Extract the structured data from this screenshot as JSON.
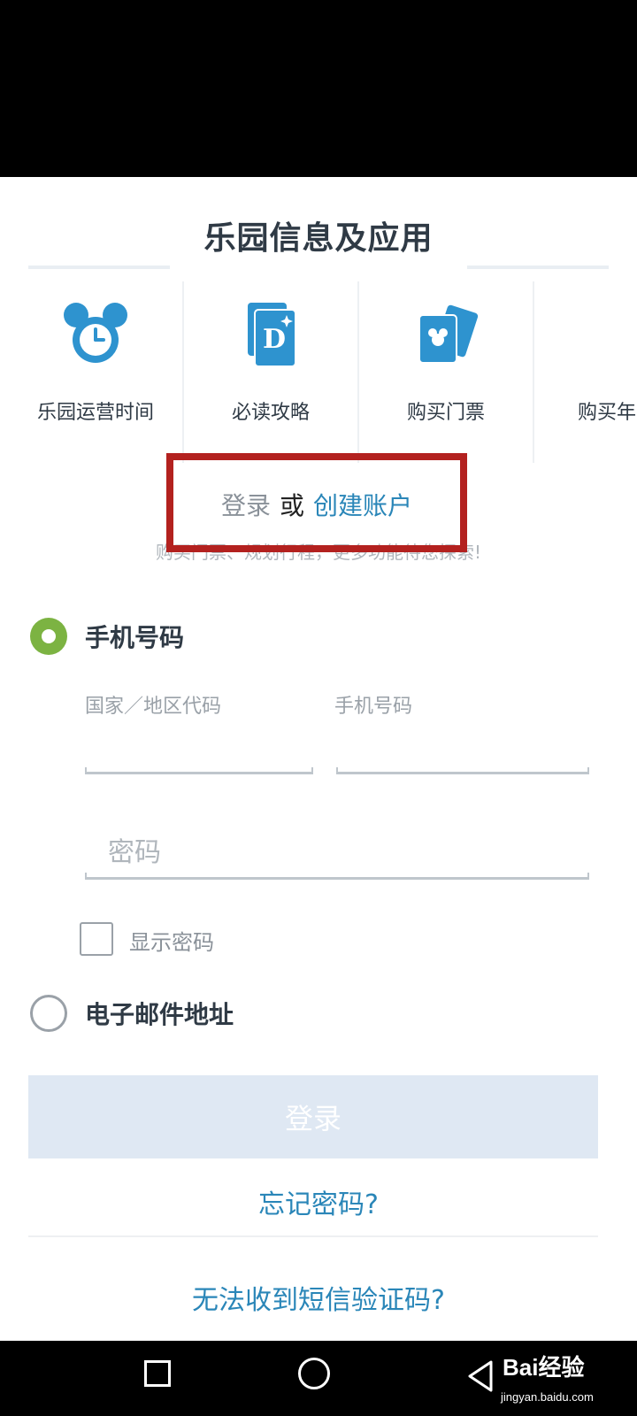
{
  "section": {
    "title": "乐园信息及应用"
  },
  "features": [
    {
      "label": "乐园运营时间",
      "icon": "mickey-clock-icon"
    },
    {
      "label": "必读攻略",
      "icon": "disney-guide-icon"
    },
    {
      "label": "购买门票",
      "icon": "tickets-icon"
    },
    {
      "label": "购买年",
      "icon": "annual-pass-icon"
    }
  ],
  "auth": {
    "login": "登录",
    "or": "或",
    "create": "创建账户"
  },
  "subtitle": "购买门票、规划行程，更多功能待您探索!",
  "phone_option": {
    "label": "手机号码",
    "country_label": "国家／地区代码",
    "phone_label": "手机号码",
    "password_placeholder": "密码",
    "show_password": "显示密码"
  },
  "email_option": {
    "label": "电子邮件地址"
  },
  "login_button": "登录",
  "forgot_password": "忘记密码?",
  "sms_help": "无法收到短信验证码?",
  "watermark": {
    "main": "Bai经验",
    "sub": "jingyan.baidu.com"
  },
  "colors": {
    "accent": "#2a86b8",
    "radio_selected": "#7cb342",
    "highlight": "#b3211f",
    "button_disabled": "#dfe8f3"
  }
}
